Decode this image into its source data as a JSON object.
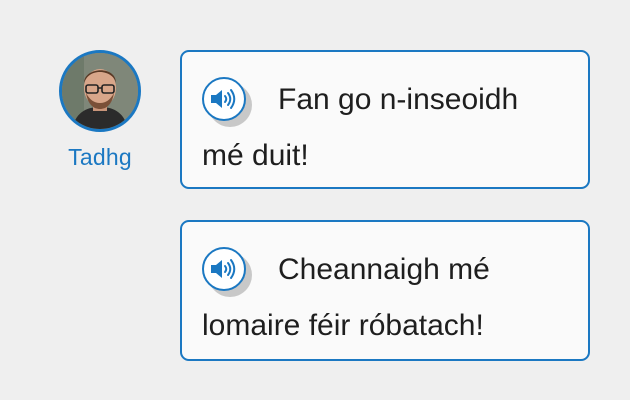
{
  "speaker": {
    "name": "Tadhg",
    "avatar_icon": "person-photo"
  },
  "messages": [
    {
      "text": "Fan go n-inseoidh mé duit!",
      "audio_icon": "speaker-icon"
    },
    {
      "text": "Cheannaigh mé lomaire féir róbatach!",
      "audio_icon": "speaker-icon"
    }
  ],
  "colors": {
    "accent": "#1b78c2",
    "background": "#efefef",
    "bubble": "#fafafa",
    "text": "#1e1e1e"
  }
}
